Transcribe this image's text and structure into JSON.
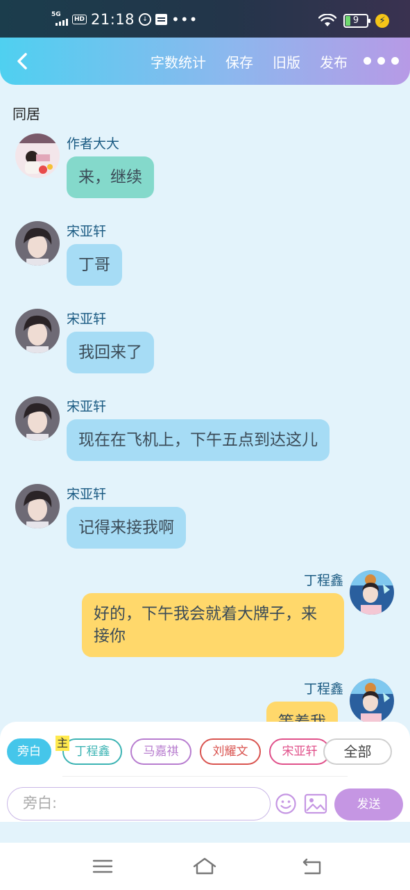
{
  "status_bar": {
    "network": "5G",
    "hd": "HD",
    "time": "21:18",
    "more": "•••",
    "battery": "9"
  },
  "toolbar": {
    "word_count": "字数统计",
    "save": "保存",
    "old_version": "旧版",
    "publish": "发布"
  },
  "chat": {
    "title": "同居",
    "messages": [
      {
        "sender": "作者大大",
        "text": "来，继续",
        "side": "left",
        "color": "teal"
      },
      {
        "sender": "宋亚轩",
        "text": "丁哥",
        "side": "left",
        "color": "blue"
      },
      {
        "sender": "宋亚轩",
        "text": "我回来了",
        "side": "left",
        "color": "blue"
      },
      {
        "sender": "宋亚轩",
        "text": "现在在飞机上，下午五点到达这儿",
        "side": "left",
        "color": "blue"
      },
      {
        "sender": "宋亚轩",
        "text": "记得来接我啊",
        "side": "left",
        "color": "blue"
      },
      {
        "sender": "丁程鑫",
        "text": "好的，下午我会就着大牌子，来接你",
        "side": "right",
        "color": "yellow"
      },
      {
        "sender": "丁程鑫",
        "text": "等着我",
        "side": "right",
        "color": "yellow"
      }
    ]
  },
  "roles": {
    "host_badge": "主",
    "chips": [
      {
        "label": "旁白",
        "color": "#45c6ea"
      },
      {
        "label": "丁程鑫",
        "color": "#3bb3b3"
      },
      {
        "label": "马嘉祺",
        "color": "#b77ccf"
      },
      {
        "label": "刘耀文",
        "color": "#d9534f"
      },
      {
        "label": "宋亚轩",
        "color": "#e0508a"
      },
      {
        "label": "全部",
        "color": "#cfcfcf"
      }
    ]
  },
  "composer": {
    "placeholder": "旁白:",
    "send": "发送"
  }
}
